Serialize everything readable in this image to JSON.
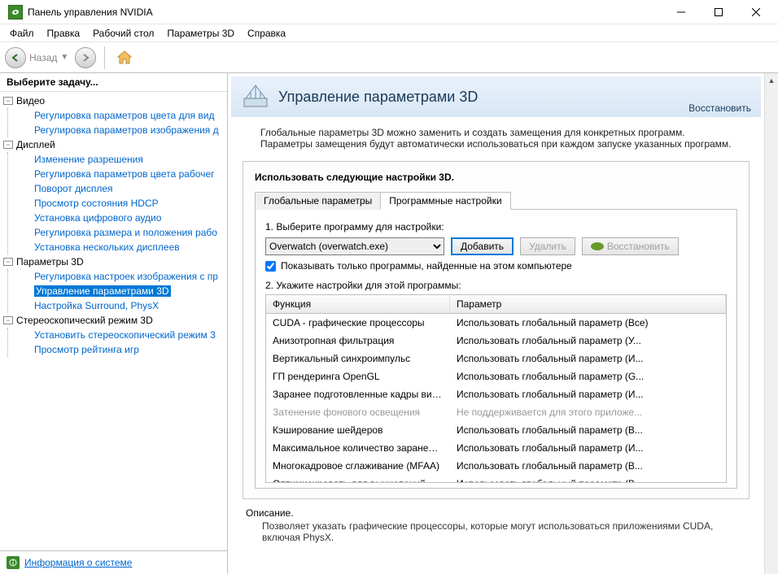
{
  "window": {
    "title": "Панель управления NVIDIA"
  },
  "menu": [
    "Файл",
    "Правка",
    "Рабочий стол",
    "Параметры 3D",
    "Справка"
  ],
  "toolbar": {
    "back_label": "Назад"
  },
  "sidebar": {
    "task_label": "Выберите задачу...",
    "groups": [
      {
        "label": "Видео",
        "items": [
          "Регулировка параметров цвета для вид",
          "Регулировка параметров изображения д"
        ]
      },
      {
        "label": "Дисплей",
        "items": [
          "Изменение разрешения",
          "Регулировка параметров цвета рабочег",
          "Поворот дисплея",
          "Просмотр состояния HDCP",
          "Установка цифрового аудио",
          "Регулировка размера и положения рабо",
          "Установка нескольких дисплеев"
        ]
      },
      {
        "label": "Параметры 3D",
        "items": [
          "Регулировка настроек изображения с пр",
          "Управление параметрами 3D",
          "Настройка Surround, PhysX"
        ]
      },
      {
        "label": "Стереоскопический режим 3D",
        "items": [
          "Установить стереоскопический режим 3",
          "Просмотр рейтинга игр"
        ]
      }
    ],
    "selected": "Управление параметрами 3D",
    "sysinfo": "Информация о системе"
  },
  "page": {
    "title": "Управление параметрами 3D",
    "restore": "Восстановить",
    "description": "Глобальные параметры 3D можно заменить и создать замещения для конкретных программ. Параметры замещения будут автоматически использоваться при каждом запуске указанных программ.",
    "box_title": "Использовать следующие настройки 3D.",
    "tabs": {
      "global": "Глобальные параметры",
      "program": "Программные настройки"
    },
    "step1": "1. Выберите программу для настройки:",
    "program_selected": "Overwatch (overwatch.exe)",
    "add_btn": "Добавить",
    "remove_btn": "Удалить",
    "restore_btn": "Восстановить",
    "show_only_this_pc": "Показывать только программы, найденные на этом компьютере",
    "step2": "2. Укажите настройки для этой программы:",
    "col_function": "Функция",
    "col_param": "Параметр",
    "rows": [
      {
        "f": "CUDA - графические процессоры",
        "p": "Использовать глобальный параметр (Все)"
      },
      {
        "f": "Анизотропная фильтрация",
        "p": "Использовать глобальный параметр (У..."
      },
      {
        "f": "Вертикальный синхроимпульс",
        "p": "Использовать глобальный параметр (И..."
      },
      {
        "f": "ГП рендеринга OpenGL",
        "p": "Использовать глобальный параметр (G..."
      },
      {
        "f": "Заранее подготовленные кадры вирту...",
        "p": "Использовать глобальный параметр (И..."
      },
      {
        "f": "Затенение фонового освещения",
        "p": "Не поддерживается для этого приложе...",
        "disabled": true
      },
      {
        "f": "Кэширование шейдеров",
        "p": "Использовать глобальный параметр (В..."
      },
      {
        "f": "Максимальное количество заранее под...",
        "p": "Использовать глобальный параметр (И..."
      },
      {
        "f": "Многокадровое сглаживание (MFAA)",
        "p": "Использовать глобальный параметр (В..."
      },
      {
        "f": "Оптимизировать для вычислений",
        "p": "Использовать глобальный параметр (В..."
      }
    ],
    "desc_label": "Описание.",
    "desc_text": "Позволяет указать графические процессоры, которые могут использоваться приложениями CUDA, включая PhysX."
  }
}
